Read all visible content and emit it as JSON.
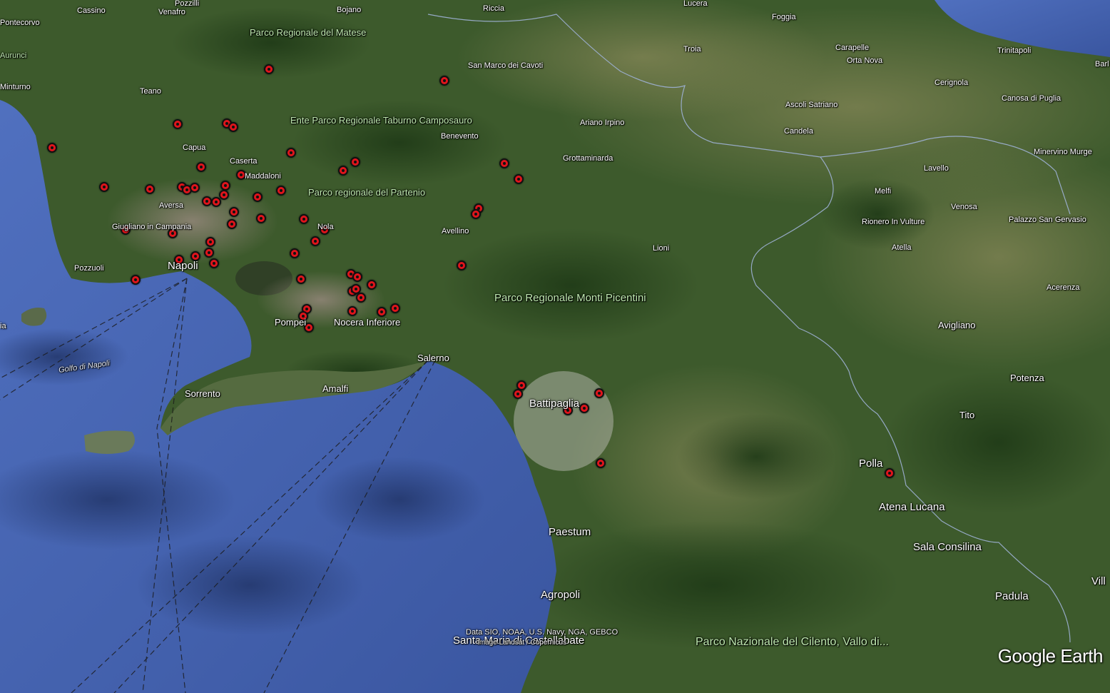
{
  "colors": {
    "sea": "#3f5ea8",
    "land": "#3d5a2c",
    "marker": "#e0141b",
    "border": "#9fb1d6"
  },
  "labels": [
    {
      "id": "cassino",
      "text": "Cassino"
    },
    {
      "id": "venafro",
      "text": "Venafro"
    },
    {
      "id": "pozzilli",
      "text": "Pozzilli"
    },
    {
      "id": "bojano",
      "text": "Bojano"
    },
    {
      "id": "riccia",
      "text": "Riccia"
    },
    {
      "id": "lucera",
      "text": "Lucera"
    },
    {
      "id": "foggia",
      "text": "Foggia"
    },
    {
      "id": "pontecorvo",
      "text": "Pontecorvo"
    },
    {
      "id": "aurunci",
      "text": "Aurunci"
    },
    {
      "id": "minturno",
      "text": "Minturno"
    },
    {
      "id": "teano",
      "text": "Teano"
    },
    {
      "id": "capua",
      "text": "Capua"
    },
    {
      "id": "caserta",
      "text": "Caserta"
    },
    {
      "id": "maddaloni",
      "text": "Maddaloni"
    },
    {
      "id": "aversa",
      "text": "Aversa"
    },
    {
      "id": "giugliano",
      "text": "Giugliano in Campania"
    },
    {
      "id": "pozzuoli",
      "text": "Pozzuoli"
    },
    {
      "id": "napoli",
      "text": "Napoli"
    },
    {
      "id": "nola",
      "text": "Nola"
    },
    {
      "id": "pompei",
      "text": "Pompei"
    },
    {
      "id": "nocera",
      "text": "Nocera Inferiore"
    },
    {
      "id": "sorrento",
      "text": "Sorrento"
    },
    {
      "id": "amalfi",
      "text": "Amalfi"
    },
    {
      "id": "salerno",
      "text": "Salerno"
    },
    {
      "id": "avellino",
      "text": "Avellino"
    },
    {
      "id": "benevento",
      "text": "Benevento"
    },
    {
      "id": "sanmarco",
      "text": "San Marco dei Cavoti"
    },
    {
      "id": "troia",
      "text": "Troia"
    },
    {
      "id": "ariano",
      "text": "Ariano Irpino"
    },
    {
      "id": "grotta",
      "text": "Grottaminarda"
    },
    {
      "id": "carapelle",
      "text": "Carapelle"
    },
    {
      "id": "ortanova",
      "text": "Orta Nova"
    },
    {
      "id": "trinitapoli",
      "text": "Trinitapoli"
    },
    {
      "id": "barl",
      "text": "Barl"
    },
    {
      "id": "cerignola",
      "text": "Cerignola"
    },
    {
      "id": "canosa",
      "text": "Canosa di Puglia"
    },
    {
      "id": "ascoli",
      "text": "Ascoli Satriano"
    },
    {
      "id": "candela",
      "text": "Candela"
    },
    {
      "id": "minervino",
      "text": "Minervino Murge"
    },
    {
      "id": "lavello",
      "text": "Lavello"
    },
    {
      "id": "melfi",
      "text": "Melfi"
    },
    {
      "id": "venosa",
      "text": "Venosa"
    },
    {
      "id": "rionero",
      "text": "Rionero In Vulture"
    },
    {
      "id": "palazzo",
      "text": "Palazzo San Gervasio"
    },
    {
      "id": "atella",
      "text": "Atella"
    },
    {
      "id": "lioni",
      "text": "Lioni"
    },
    {
      "id": "acerenza",
      "text": "Acerenza"
    },
    {
      "id": "avigliano",
      "text": "Avigliano"
    },
    {
      "id": "potenza",
      "text": "Potenza"
    },
    {
      "id": "tito",
      "text": "Tito"
    },
    {
      "id": "battipaglia",
      "text": "Battipaglia"
    },
    {
      "id": "polla",
      "text": "Polla"
    },
    {
      "id": "atena",
      "text": "Atena Lucana"
    },
    {
      "id": "paestum",
      "text": "Paestum"
    },
    {
      "id": "sala",
      "text": "Sala Consilina"
    },
    {
      "id": "padula",
      "text": "Padula"
    },
    {
      "id": "vill",
      "text": "Vill"
    },
    {
      "id": "agropoli",
      "text": "Agropoli"
    },
    {
      "id": "santamaria",
      "text": "Santa Maria di Castellabate"
    },
    {
      "id": "golfo",
      "text": "Golfo di Napoli"
    },
    {
      "id": "ischia",
      "text": "ia"
    }
  ],
  "parks": [
    {
      "id": "matese",
      "text": "Parco Regionale del Matese"
    },
    {
      "id": "taburno",
      "text": "Ente Parco Regionale Taburno Camposauro"
    },
    {
      "id": "partenio",
      "text": "Parco regionale del Partenio"
    },
    {
      "id": "picentini",
      "text": "Parco Regionale Monti Picentini"
    },
    {
      "id": "cilento",
      "text": "Parco Nazionale del Cilento, Vallo di..."
    }
  ],
  "attribution": {
    "line1": "Data SIO, NOAA, U.S. Navy, NGA, GEBCO",
    "line2": "Image Landsat / Copernicus"
  },
  "logo": "Google Earth",
  "markers_count": 62
}
